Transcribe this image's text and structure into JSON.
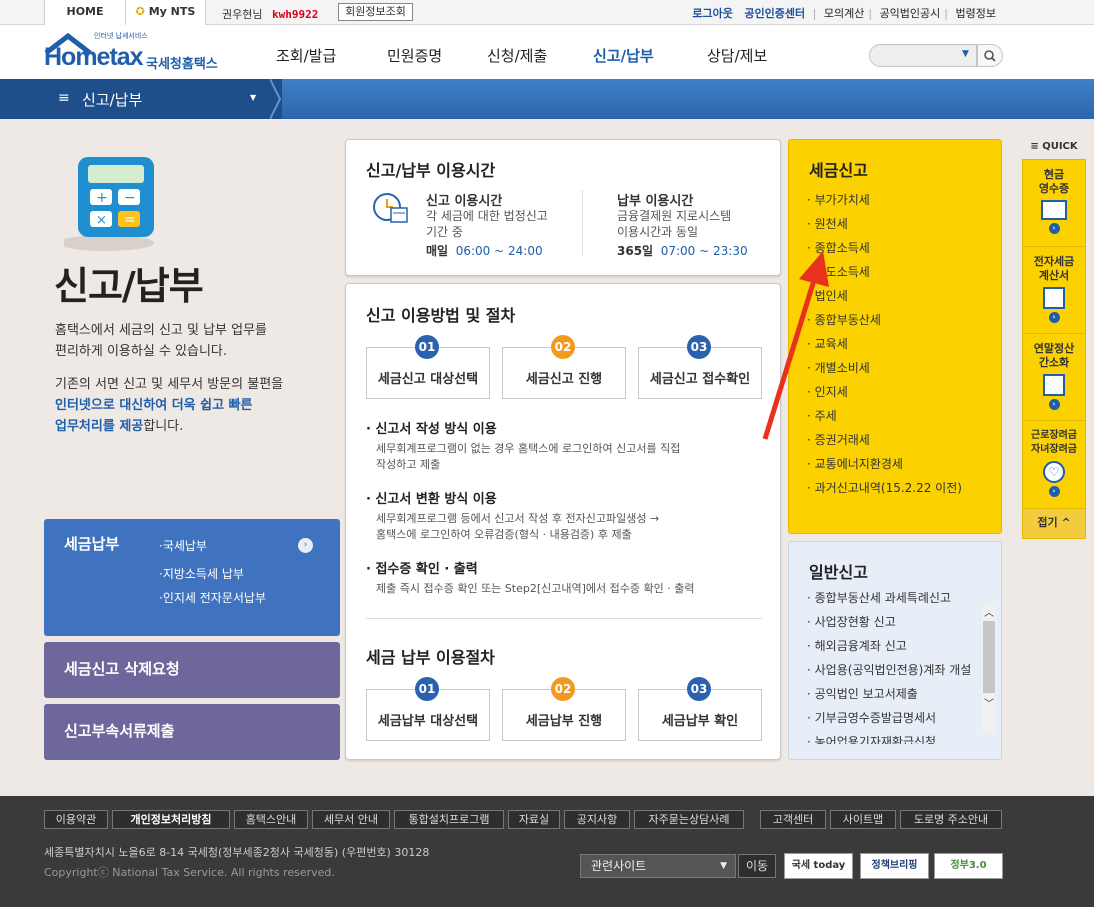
{
  "topbar": {
    "home_label": "HOME",
    "mynts_label": "My NTS",
    "user_greeting": "권우현님",
    "user_id": "kwh9922",
    "member_info_button": "회원정보조회",
    "links": [
      "로그아웃",
      "공인인증센터",
      "모의계산",
      "공익법인공시",
      "법령정보"
    ]
  },
  "header": {
    "logo_tagline": "인터넷 납세서비스",
    "logo_text": "Hometax",
    "logo_subtitle": "국세청홈택스",
    "nav": [
      "조회/발급",
      "민원증명",
      "신청/제출",
      "신고/납부",
      "상담/제보"
    ]
  },
  "navbar": {
    "current_menu": "신고/납부"
  },
  "hero": {
    "title": "신고/납부",
    "desc1": "홈택스에서 세금의 신고 및 납부 업무를",
    "desc2": "편리하게 이용하실 수 있습니다.",
    "desc3": "기존의 서면 신고 및 세무서 방문의 불편을",
    "desc4_highlight": "인터넷으로 대신하여 더욱 쉽고 빠른",
    "desc5_highlight": "업무처리를 제공",
    "desc5_tail": "합니다."
  },
  "payment_box": {
    "title": "세금납부",
    "items": [
      "·국세납부",
      "·지방소득세 납부",
      "·인지세 전자문서납부"
    ]
  },
  "delete_request_button": "세금신고 삭제요청",
  "attachment_button": "신고부속서류제출",
  "usage_time": {
    "title": "신고/납부 이용시간",
    "filing_title": "신고 이용시간",
    "filing_desc1": "각 세금에 대한 법정신고",
    "filing_desc2": "기간 중",
    "filing_days": "매일",
    "filing_hours": "06:00 ~ 24:00",
    "pay_title": "납부 이용시간",
    "pay_desc1": "금융결제원 지로시스템",
    "pay_desc2": "이용시간과 동일",
    "pay_days": "365일",
    "pay_hours": "07:00 ~ 23:30"
  },
  "procedure": {
    "title": "신고 이용방법 및 절차",
    "steps": [
      {
        "num": "01",
        "label": "세금신고 대상선택"
      },
      {
        "num": "02",
        "label": "세금신고 진행"
      },
      {
        "num": "03",
        "label": "세금신고 접수확인"
      }
    ],
    "methods": [
      {
        "title": "신고서 작성 방식 이용",
        "line1": "세무회계프로그램이 없는 경우 홈택스에 로그인하여 신고서를 직접",
        "line2": "작성하고 제출"
      },
      {
        "title": "신고서 변환 방식 이용",
        "line1": "세무회계프로그램 등에서 신고서 작성 후 전자신고파일생성 →",
        "line2": "홈택스에 로그인하여 오류검증(형식 · 내용검증) 후 제출"
      },
      {
        "title": "접수증 확인 · 출력",
        "line1": "제출 즉시 접수증 확인 또는 Step2[신고내역]에서 접수증 확인 · 출력",
        "line2": ""
      }
    ],
    "pay_title": "세금 납부 이용절차",
    "pay_steps": [
      {
        "num": "01",
        "label": "세금납부 대상선택"
      },
      {
        "num": "02",
        "label": "세금납부 진행"
      },
      {
        "num": "03",
        "label": "세금납부 확인"
      }
    ]
  },
  "tax_filing": {
    "title": "세금신고",
    "items": [
      "부가가치세",
      "원천세",
      "종합소득세",
      "양도소득세",
      "법인세",
      "종합부동산세",
      "교육세",
      "개별소비세",
      "인지세",
      "주세",
      "증권거래세",
      "교통에너지환경세",
      "과거신고내역(15.2.22 이전)"
    ]
  },
  "general_filing": {
    "title": "일반신고",
    "items": [
      "종합부동산세 과세특례신고",
      "사업장현황 신고",
      "해외금융계좌 신고",
      "사업용(공익법인전용)계좌 개설",
      "공익법인 보고서제출",
      "기부금영수증발급명세서",
      "농어업용기자재환급신청"
    ]
  },
  "quick": {
    "title": "QUICK",
    "items": [
      {
        "l1": "현금",
        "l2": "영수증"
      },
      {
        "l1": "전자세금",
        "l2": "계산서"
      },
      {
        "l1": "연말정산",
        "l2": "간소화"
      },
      {
        "l1": "근로장려금",
        "l2": "자녀장려금"
      }
    ],
    "fold_label": "접기"
  },
  "footer": {
    "links": [
      "이용약관",
      "개인정보처리방침",
      "홈택스안내",
      "세무서 안내",
      "통합설치프로그램",
      "자료실",
      "공지사항",
      "자주묻는상담사례"
    ],
    "links_right": [
      "고객센터",
      "사이트맵",
      "도로명 주소안내"
    ],
    "address": "세종특별자치시 노을6로 8-14 국세청(정부세종2청사 국세청동) (우편번호) 30128",
    "copyright": "Copyrightⓒ National Tax Service. All rights reserved.",
    "related_sites": "관련사이트",
    "go_button": "이동",
    "banners": [
      "국세 today",
      "정책브리핑",
      "정부3.0"
    ]
  },
  "colors": {
    "brand_blue": "#1f5ea8",
    "payment_blue": "#3f73c0",
    "purple": "#6d679c",
    "yellow": "#fbd100",
    "arrow_red": "#e8321e",
    "step_blue": "#2a62ad",
    "step_orange": "#f39a1e"
  }
}
